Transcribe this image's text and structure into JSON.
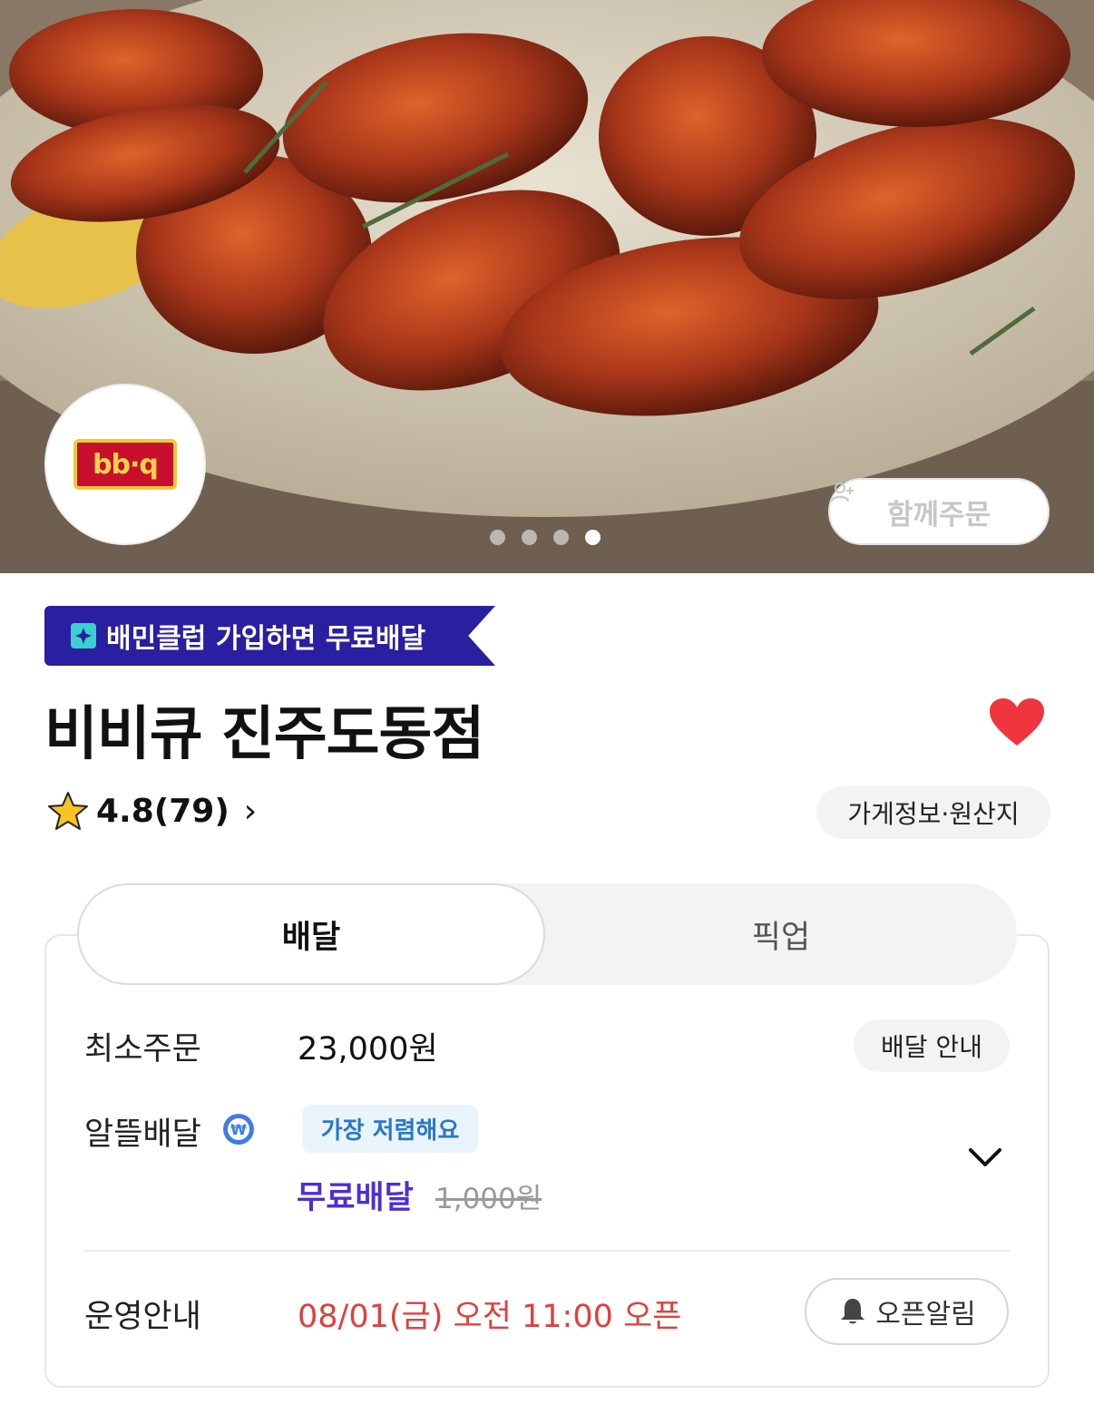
{
  "hero": {
    "logo_text": "bb·q",
    "together_order_label": "함께주문",
    "carousel": {
      "count": 4,
      "active_index": 3
    }
  },
  "club_banner": {
    "label": "배민클럽 가입하면 무료배달"
  },
  "store": {
    "name": "비비큐 진주도동점",
    "favorited": true,
    "rating": "4.8(79)",
    "info_chip": "가게정보·원산지"
  },
  "tabs": [
    {
      "label": "배달",
      "active": true
    },
    {
      "label": "픽업",
      "active": false
    }
  ],
  "delivery": {
    "min_order_label": "최소주문",
    "min_order_value": "23,000원",
    "delivery_info_chip": "배달 안내",
    "saver_label": "알뜰배달",
    "cheapest_tag": "가장 저렴해요",
    "free_delivery": "무료배달",
    "original_fee": "1,000원",
    "hours_label": "운영안내",
    "open_time": "08/01(금) 오전 11:00 오픈",
    "open_alarm_label": "오픈알림"
  },
  "colors": {
    "club": "#2a1fa0",
    "heart": "#f0353c",
    "free_delivery": "#4a2fd8",
    "open_time": "#e0403c",
    "cheap_tag": "#2a77c9"
  }
}
